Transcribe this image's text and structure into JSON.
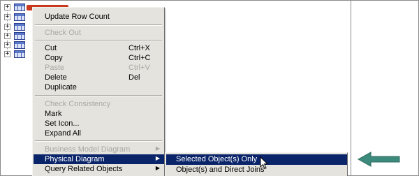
{
  "tree": {
    "expander_symbol": "+",
    "rows": [
      0,
      1,
      2,
      3,
      4,
      5
    ]
  },
  "menu": {
    "items": [
      {
        "label": "Update Row Count",
        "shortcut": "",
        "disabled": false
      },
      {
        "label": "Check Out",
        "shortcut": "",
        "disabled": true
      },
      {
        "label": "Cut",
        "shortcut": "Ctrl+X",
        "disabled": false
      },
      {
        "label": "Copy",
        "shortcut": "Ctrl+C",
        "disabled": false
      },
      {
        "label": "Paste",
        "shortcut": "Ctrl+V",
        "disabled": true
      },
      {
        "label": "Delete",
        "shortcut": "Del",
        "disabled": false
      },
      {
        "label": "Duplicate",
        "shortcut": "",
        "disabled": false
      },
      {
        "label": "Check Consistency",
        "shortcut": "",
        "disabled": true
      },
      {
        "label": "Mark",
        "shortcut": "",
        "disabled": false
      },
      {
        "label": "Set Icon...",
        "shortcut": "",
        "disabled": false
      },
      {
        "label": "Expand All",
        "shortcut": "",
        "disabled": false
      },
      {
        "label": "Business Model Diagram",
        "shortcut": "",
        "disabled": true,
        "submenu": true
      },
      {
        "label": "Physical Diagram",
        "shortcut": "",
        "disabled": false,
        "submenu": true,
        "highlighted": true
      },
      {
        "label": "Query Related Objects",
        "shortcut": "",
        "disabled": false,
        "submenu": true
      }
    ],
    "submenu_arrow": "▶"
  },
  "submenu": {
    "items": [
      {
        "label": "Selected Object(s) Only",
        "highlighted": true
      },
      {
        "label": "Object(s) and Direct Joins",
        "highlighted": false
      }
    ]
  },
  "colors": {
    "menu_bg": "#e4e3dd",
    "highlight": "#0a246a",
    "disabled_text": "#a9a8a2",
    "annotation_arrow": "#3b8a7c"
  }
}
